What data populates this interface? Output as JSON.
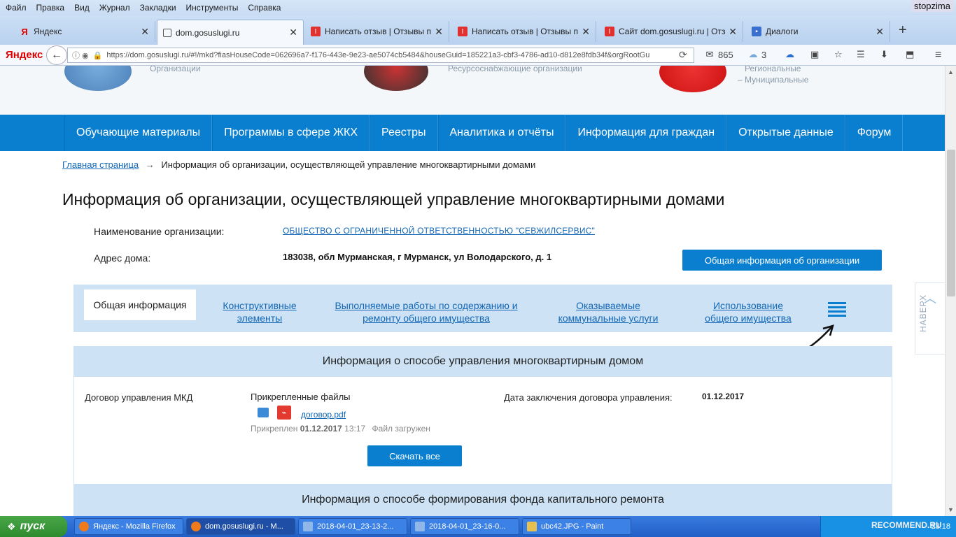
{
  "browser": {
    "menu": [
      "Файл",
      "Правка",
      "Вид",
      "Журнал",
      "Закладки",
      "Инструменты",
      "Справка"
    ],
    "watermark": "stopzima",
    "tabs": [
      {
        "label": "Яндекс",
        "icon": "yandex-icon"
      },
      {
        "label": "dom.gosuslugi.ru",
        "icon": "page-icon"
      },
      {
        "label": "Написать отзыв | Отзывы п...",
        "icon": "irecommend-icon"
      },
      {
        "label": "Написать отзыв | Отзывы п...",
        "icon": "irecommend-icon"
      },
      {
        "label": "Сайт dom.gosuslugi.ru | Отз...",
        "icon": "irecommend-icon"
      },
      {
        "label": "Диалоги",
        "icon": "chat-icon"
      }
    ],
    "close_glyph": "✕",
    "new_tab_glyph": "+",
    "logo": "Яндекс",
    "url": "https://dom.gosuslugi.ru/#!/mkd?fiasHouseCode=062696a7-f176-443e-9e23-ae5074cb5484&houseGuid=185221a3-cbf3-4786-ad10-d812e8fdb34f&orgRootGu",
    "mail_count": "865",
    "weather": "3"
  },
  "hero": {
    "left_caption": "Организации",
    "center_caption": "Ресурсоснабжающие организации",
    "right_caption_1": "Региональные",
    "right_caption_2": "– Муниципальные"
  },
  "nav": {
    "items": [
      "Обучающие материалы",
      "Программы в сфере ЖКХ",
      "Реестры",
      "Аналитика и отчёты",
      "Информация для граждан",
      "Открытые данные",
      "Форум"
    ]
  },
  "breadcrumb": {
    "home": "Главная страница",
    "sep": "→",
    "current": "Информация об организации, осуществляющей управление многоквартирными домами"
  },
  "page_title": "Информация об организации, осуществляющей управление многоквартирными домами",
  "org": {
    "name_label": "Наименование организации:",
    "name_value": "ОБЩЕСТВО С ОГРАНИЧЕННОЙ ОТВЕТСТВЕННОСТЬЮ \"СЕВЖИЛСЕРВИС\"",
    "address_label": "Адрес дома:",
    "address_value": "183038, обл Мурманская, г Мурманск, ул Володарского, д. 1",
    "info_button": "Общая информация об организации"
  },
  "tabs": {
    "general": "Общая информация",
    "constructive_1": "Конструктивные",
    "constructive_2": "элементы",
    "works_1": "Выполняемые работы по содержанию и",
    "works_2": "ремонту общего имущества",
    "services_1": "Оказываемые",
    "services_2": "коммунальные услуги",
    "usage_1": "Использование",
    "usage_2": "общего имущества"
  },
  "naverh": "НАВЕРХ",
  "section1": {
    "title": "Информация о способе управления многоквартирным домом",
    "contract_label": "Договор управления МКД",
    "attached_label": "Прикрепленные файлы",
    "file_name": "договор.pdf",
    "attached_prefix": "Прикреплен",
    "attached_date": "01.12.2017",
    "attached_time": "13:17",
    "attached_status": "Файл загружен",
    "date_label": "Дата заключения договора управления:",
    "date_value": "01.12.2017",
    "download_button": "Скачать все"
  },
  "section2": {
    "title": "Информация о способе формирования фонда капитального ремонта"
  },
  "taskbar": {
    "start": "пуск",
    "tasks": [
      "Яндекс - Mozilla Firefox",
      "dom.gosuslugi.ru - M...",
      "2018-04-01_23-13-2...",
      "2018-04-01_23-16-0...",
      "ubc42.JPG - Paint"
    ],
    "watermark": "RECOMMEND.RU",
    "clock": "23:18"
  }
}
